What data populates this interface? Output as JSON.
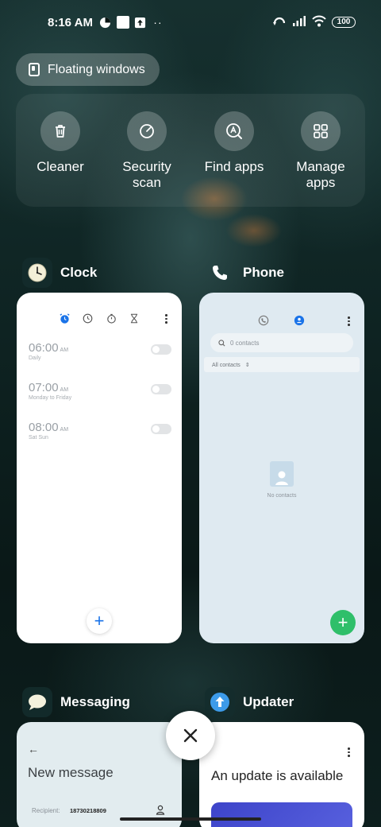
{
  "status_bar": {
    "time": "8:16 AM",
    "battery": "100"
  },
  "floating_windows": {
    "label": "Floating windows"
  },
  "quick_actions": [
    {
      "label": "Cleaner",
      "icon": "trash-icon"
    },
    {
      "label": "Security\nscan",
      "icon": "security-scan-icon"
    },
    {
      "label": "Find apps",
      "icon": "find-apps-icon"
    },
    {
      "label": "Manage\napps",
      "icon": "grid-icon"
    }
  ],
  "apps": {
    "clock": {
      "name": "Clock",
      "alarms": [
        {
          "time": "06:00",
          "ampm": "AM",
          "days": "Daily"
        },
        {
          "time": "07:00",
          "ampm": "AM",
          "days": "Monday to Friday"
        },
        {
          "time": "08:00",
          "ampm": "AM",
          "days": "Sat Sun"
        }
      ]
    },
    "phone": {
      "name": "Phone",
      "search_placeholder": "0 contacts",
      "filter": "All contacts",
      "empty_text": "No contacts"
    },
    "messaging": {
      "name": "Messaging",
      "title": "New message",
      "recipient_label": "Recipient:",
      "recipient_number": "18730218809"
    },
    "updater": {
      "name": "Updater",
      "title": "An update is available"
    }
  },
  "colors": {
    "accent_blue": "#1a73e8",
    "phone_fab": "#2fbf6a",
    "updater_banner": "#3d44c9"
  }
}
